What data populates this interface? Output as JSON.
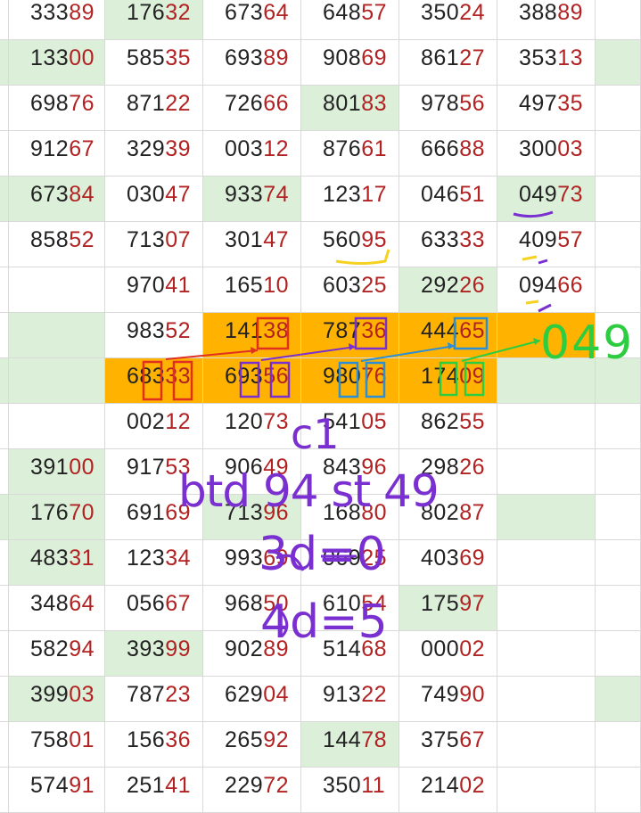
{
  "rows": [
    [
      "33389",
      "17632",
      "67364",
      "64857",
      "35024",
      "38889"
    ],
    [
      "13300",
      "58535",
      "69389",
      "90869",
      "86127",
      "35313"
    ],
    [
      "69876",
      "87122",
      "72666",
      "80183",
      "97856",
      "49735"
    ],
    [
      "91267",
      "32939",
      "00312",
      "87661",
      "66688",
      "30003"
    ],
    [
      "67384",
      "03047",
      "93374",
      "12317",
      "04651",
      "04973"
    ],
    [
      "85852",
      "71307",
      "30147",
      "56095",
      "63333",
      "40957"
    ],
    [
      "",
      "97041",
      "16510",
      "60325",
      "29226",
      "09466"
    ],
    [
      "",
      "98352",
      "14138",
      "78736",
      "44465",
      ""
    ],
    [
      "",
      "68333",
      "69356",
      "98076",
      "17409",
      ""
    ],
    [
      "",
      "00212",
      "12073",
      "54105",
      "86255",
      ""
    ],
    [
      "39100",
      "91753",
      "90649",
      "84396",
      "29826",
      ""
    ],
    [
      "17670",
      "69169",
      "71396",
      "16880",
      "80287",
      ""
    ],
    [
      "48331",
      "12334",
      "99369",
      "06925",
      "40369",
      ""
    ],
    [
      "34864",
      "05667",
      "96850",
      "61054",
      "17597",
      ""
    ],
    [
      "58294",
      "39399",
      "90289",
      "51468",
      "00002",
      ""
    ],
    [
      "39903",
      "78723",
      "62904",
      "91322",
      "74990",
      ""
    ],
    [
      "75801",
      "15636",
      "26592",
      "14478",
      "37567",
      ""
    ],
    [
      "57491",
      "25141",
      "22972",
      "35011",
      "21402",
      ""
    ]
  ],
  "annotations": {
    "handwritten_049": "049",
    "c1": "c1",
    "btd": "btd 94 st 49",
    "d3": "3d=0",
    "d4": "4d=5"
  },
  "colors": {
    "green_cell": "#dbefd9",
    "orange_cell": "#ffb300",
    "ink_purple": "#7a2fd0",
    "ink_green": "#2ecc40",
    "ink_red": "#e03020",
    "ink_blue": "#2a8fd8",
    "ink_yellow": "#f4d21f"
  }
}
